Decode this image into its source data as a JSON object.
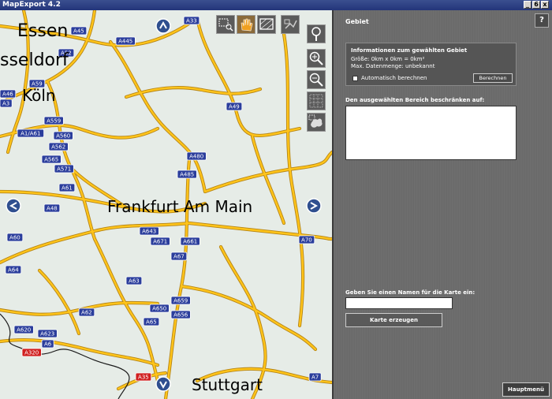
{
  "window": {
    "title": "MapExport 4.2",
    "buttons": [
      "_",
      "6",
      "x"
    ]
  },
  "map": {
    "cities": [
      {
        "id": "essen",
        "label": "Essen"
      },
      {
        "id": "duesseldorf",
        "label": "sseldorf"
      },
      {
        "id": "koeln",
        "label": "Köln"
      },
      {
        "id": "frankfurt",
        "label": "Frankfurt Am Main"
      },
      {
        "id": "stuttgart",
        "label": "Stuttgart"
      }
    ],
    "shields": [
      {
        "label": "A45",
        "color": "blue"
      },
      {
        "label": "A33",
        "color": "blue"
      },
      {
        "label": "A445",
        "color": "blue"
      },
      {
        "label": "A52",
        "color": "blue"
      },
      {
        "label": "A59",
        "color": "blue"
      },
      {
        "label": "A46",
        "color": "blue"
      },
      {
        "label": "A3",
        "color": "blue"
      },
      {
        "label": "A49",
        "color": "blue"
      },
      {
        "label": "A559",
        "color": "blue"
      },
      {
        "label": "A1/A61",
        "color": "blue"
      },
      {
        "label": "A560",
        "color": "blue"
      },
      {
        "label": "A562",
        "color": "blue"
      },
      {
        "label": "A565",
        "color": "blue"
      },
      {
        "label": "A571",
        "color": "blue"
      },
      {
        "label": "A61",
        "color": "blue"
      },
      {
        "label": "A480",
        "color": "blue"
      },
      {
        "label": "A485",
        "color": "blue"
      },
      {
        "label": "A48",
        "color": "blue"
      },
      {
        "label": "A60",
        "color": "blue"
      },
      {
        "label": "A643",
        "color": "blue"
      },
      {
        "label": "A671",
        "color": "blue"
      },
      {
        "label": "A661",
        "color": "blue"
      },
      {
        "label": "A67",
        "color": "blue"
      },
      {
        "label": "A70",
        "color": "blue"
      },
      {
        "label": "A64",
        "color": "blue"
      },
      {
        "label": "A63",
        "color": "blue"
      },
      {
        "label": "A659",
        "color": "blue"
      },
      {
        "label": "A62",
        "color": "blue"
      },
      {
        "label": "A650",
        "color": "blue"
      },
      {
        "label": "A65",
        "color": "blue"
      },
      {
        "label": "A656",
        "color": "blue"
      },
      {
        "label": "A620",
        "color": "blue"
      },
      {
        "label": "A623",
        "color": "blue"
      },
      {
        "label": "A6",
        "color": "blue"
      },
      {
        "label": "A320",
        "color": "red"
      },
      {
        "label": "A35",
        "color": "red"
      },
      {
        "label": "A7",
        "color": "blue"
      }
    ]
  },
  "toolbar_icons": [
    "zoom-rect-icon",
    "hand-icon",
    "select-area-icon",
    "rotate-icon",
    "info-icon",
    "zoom-in-icon",
    "zoom-out-icon",
    "grid-icon",
    "europe-icon"
  ],
  "panel": {
    "title": "Gebiet",
    "help_label": "?",
    "info": {
      "title": "Informationen zum gewählten Gebiet",
      "size": "Größe: 0km x 0km = 0km²",
      "datasize": "Max. Datenmenge: unbekannt",
      "auto_label": "Automatisch berechnen",
      "calc_button": "Berechnen"
    },
    "restrict_label": "Den ausgewählten Bereich beschränken auf:",
    "name_label": "Geben Sie einen Namen für die Karte ein:",
    "name_value": "",
    "create_button": "Karte erzeugen",
    "main_menu_button": "Hauptmenü"
  }
}
